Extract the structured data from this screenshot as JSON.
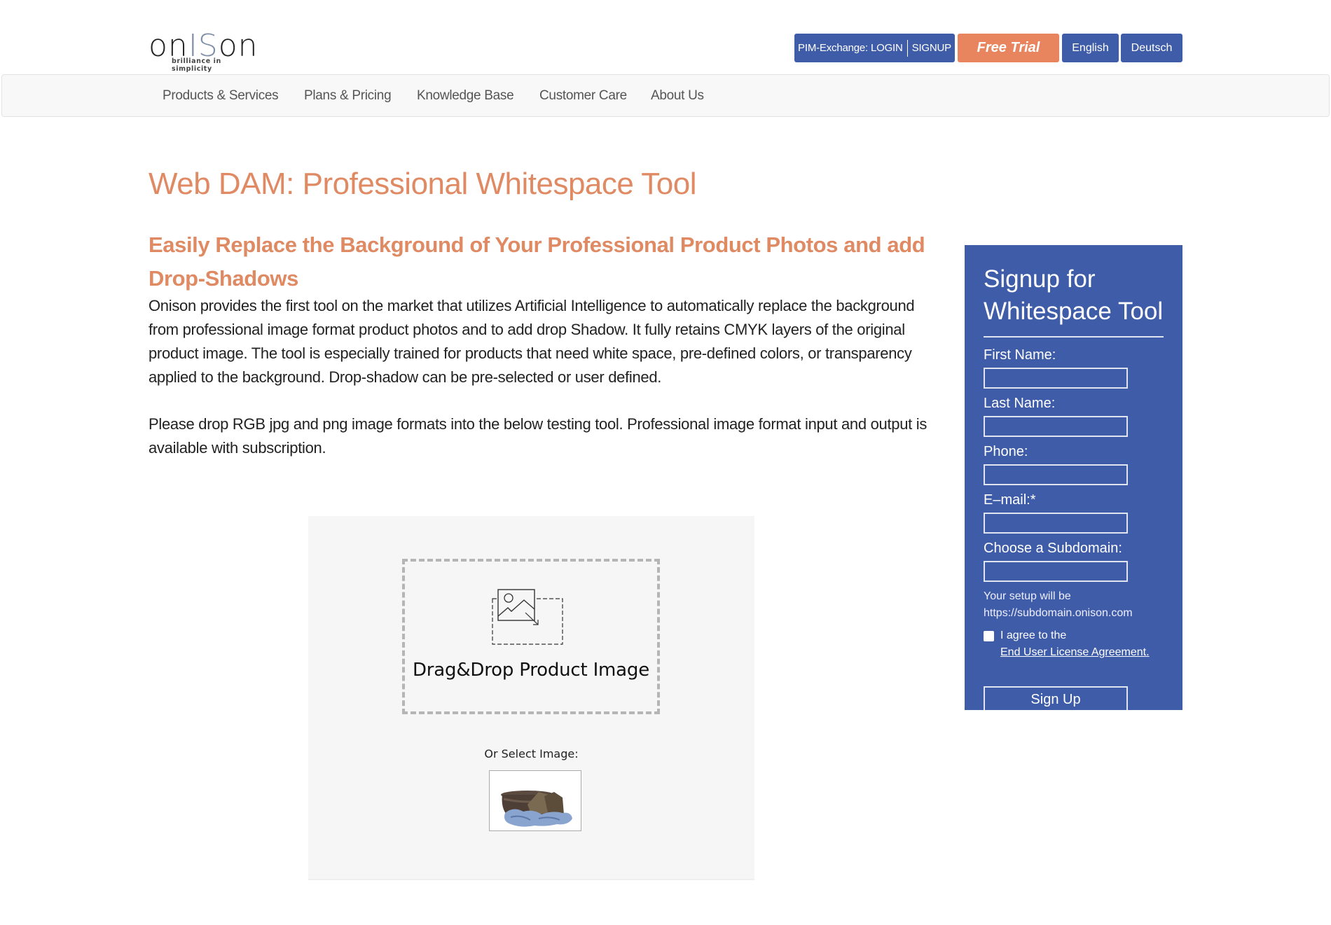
{
  "header": {
    "logo": {
      "word_start": "on",
      "word_mid": "IS",
      "word_end": "on",
      "tagline": "brilliance in simplicity"
    },
    "pim_login": "PIM-Exchange: LOGIN",
    "pim_signup": "SIGNUP",
    "free_trial": "Free Trial",
    "lang_english": "English",
    "lang_deutsch": "Deutsch"
  },
  "nav": {
    "items": [
      {
        "label": "Products & Services"
      },
      {
        "label": "Plans & Pricing"
      },
      {
        "label": "Knowledge Base"
      },
      {
        "label": "Customer Care"
      },
      {
        "label": "About Us"
      }
    ]
  },
  "main": {
    "title": "Web DAM: Professional Whitespace Tool",
    "subtitle": "Easily Replace the Background of Your Professional Product Photos and add Drop-Shadows",
    "paragraph1": "Onison provides the first tool on the market that utilizes Artificial Intelligence to automatically replace the background from professional image format product photos and to add drop Shadow. It fully retains CMYK layers of the original product image. The tool is especially trained for products that need white space, pre-defined colors, or transparency applied to the background. Drop-shadow can be pre-selected or user defined.",
    "paragraph2": "Please drop RGB jpg and png image formats into the below testing tool. Professional image format input and output is available with subscription."
  },
  "tool": {
    "dropzone_label": "Drag&Drop Product Image",
    "dropzone_icon": "image-drag-icon",
    "select_label": "Or Select Image:",
    "sample_image": "sample-product-image (boots and tire)"
  },
  "signup": {
    "title": "Signup for Whitespace Tool",
    "fields": [
      {
        "label": "First Name:",
        "value": ""
      },
      {
        "label": "Last Name:",
        "value": ""
      },
      {
        "label": "Phone:",
        "value": ""
      },
      {
        "label": "E–mail:*",
        "value": ""
      },
      {
        "label": "Choose a Subdomain:",
        "value": ""
      }
    ],
    "note_line1": "Your setup will be",
    "note_line2": "https://subdomain.onison.com",
    "agree_text": "I agree to the",
    "eula_link": "End User License Agreement.",
    "agree_checked": false,
    "submit_label": "Sign Up"
  },
  "colors": {
    "brand_blue": "#3f5ca8",
    "accent_orange": "#e8855e",
    "heading_orange": "#e08a64"
  }
}
